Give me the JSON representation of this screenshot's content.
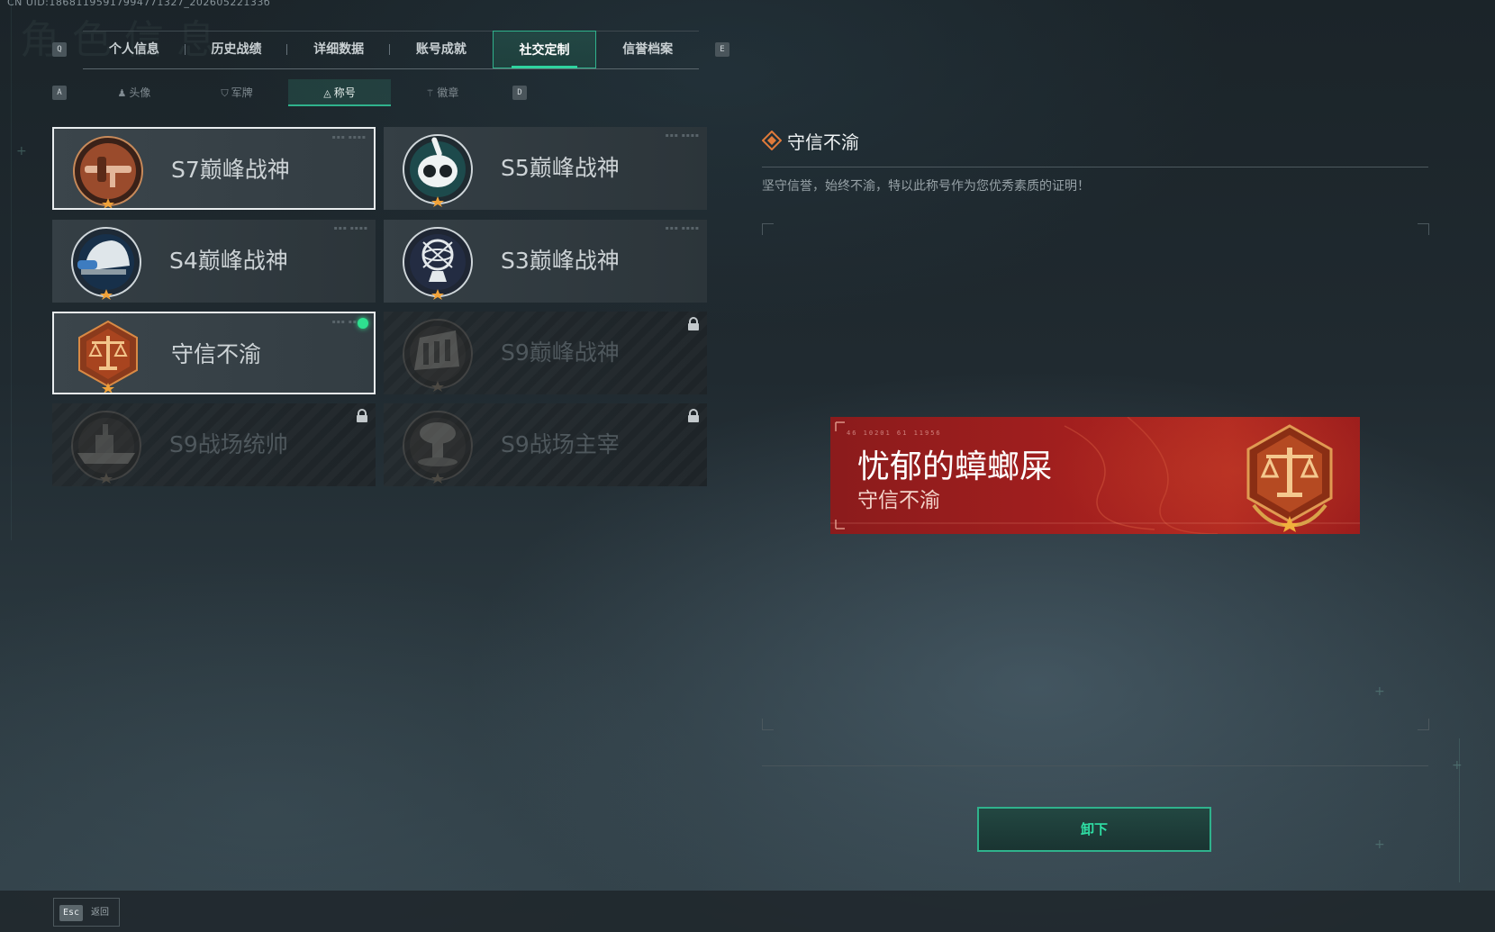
{
  "header": {
    "uid_text": "CN UID:18681195917994771327_20260522133б",
    "ghost_title": "角色信息",
    "prev_key": "Q",
    "next_key": "E"
  },
  "tabs": [
    {
      "label": "个人信息",
      "active": false
    },
    {
      "label": "历史战绩",
      "active": false
    },
    {
      "label": "详细数据",
      "active": false
    },
    {
      "label": "账号成就",
      "active": false
    },
    {
      "label": "社交定制",
      "active": true
    },
    {
      "label": "信誉档案",
      "active": false
    }
  ],
  "subtabs": {
    "prev_key": "A",
    "next_key": "D",
    "items": [
      {
        "label": "头像",
        "icon": "person-icon",
        "glyph": "♟",
        "active": false
      },
      {
        "label": "军牌",
        "icon": "dogtag-icon",
        "glyph": "⛉",
        "active": false
      },
      {
        "label": "称号",
        "icon": "title-icon",
        "glyph": "◬",
        "active": true
      },
      {
        "label": "徽章",
        "icon": "badge-icon",
        "glyph": "⚚",
        "active": false
      }
    ]
  },
  "titles": [
    {
      "name": "S7巅峰战神",
      "emblem": "s7-crossbow-emblem-icon",
      "state": "selected"
    },
    {
      "name": "S5巅峰战神",
      "emblem": "s5-skull-emblem-icon",
      "state": "normal"
    },
    {
      "name": "S4巅峰战神",
      "emblem": "s4-helmet-emblem-icon",
      "state": "normal"
    },
    {
      "name": "S3巅峰战神",
      "emblem": "s3-globe-emblem-icon",
      "state": "normal"
    },
    {
      "name": "守信不渝",
      "emblem": "scales-emblem-icon",
      "state": "equipped"
    },
    {
      "name": "S9巅峰战神",
      "emblem": "s9-fortress-emblem-icon",
      "state": "locked"
    },
    {
      "name": "S9战场统帅",
      "emblem": "s9-warship-emblem-icon",
      "state": "locked"
    },
    {
      "name": "S9战场主宰",
      "emblem": "s9-mushroom-cloud-emblem-icon",
      "state": "locked"
    }
  ],
  "detail": {
    "title": "守信不渝",
    "description": "坚守信誉，始终不渝，特以此称号作为您优秀素质的证明！"
  },
  "nameplate": {
    "player_name": "忧郁的蟑螂屎",
    "title": "守信不渝",
    "code": "46  10201   61  11956"
  },
  "actions": {
    "unequip_label": "卸下",
    "back_key": "Esc",
    "back_label": "返回"
  },
  "colors": {
    "accent": "#2fb28c",
    "equipped": "#2ee08f",
    "plate_red": "#a21f1e",
    "emblem_bronze": "#b5672f"
  }
}
